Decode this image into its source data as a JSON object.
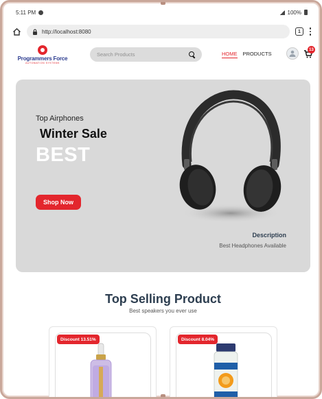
{
  "status_bar": {
    "time": "5:11 PM",
    "battery": "100%"
  },
  "browser": {
    "url": "http://localhost:8080",
    "tabs_count": "1"
  },
  "header": {
    "logo_text": "Programmers Force",
    "logo_tagline": "AUTOMATION SYSTEMS",
    "search_placeholder": "Search Products",
    "nav": {
      "home": "HOME",
      "products": "PRODUCTS"
    },
    "cart_count": "13"
  },
  "hero": {
    "eyebrow": "Top Airphones",
    "title": "Winter Sale",
    "big_text": "BEST",
    "button_label": "Shop Now",
    "description_title": "Description",
    "description_text": "Best Headphones Available"
  },
  "section": {
    "title": "Top Selling Product",
    "subtitle": "Best speakers you ever use"
  },
  "products": [
    {
      "discount": "Discount 13.51%",
      "image": "serum-bottle"
    },
    {
      "discount": "Discount 8.04%",
      "image": "orange-drink-bottle"
    }
  ],
  "colors": {
    "accent": "#e3262d",
    "hero_bg": "#d9d9d9",
    "heading": "#2d3e50"
  }
}
